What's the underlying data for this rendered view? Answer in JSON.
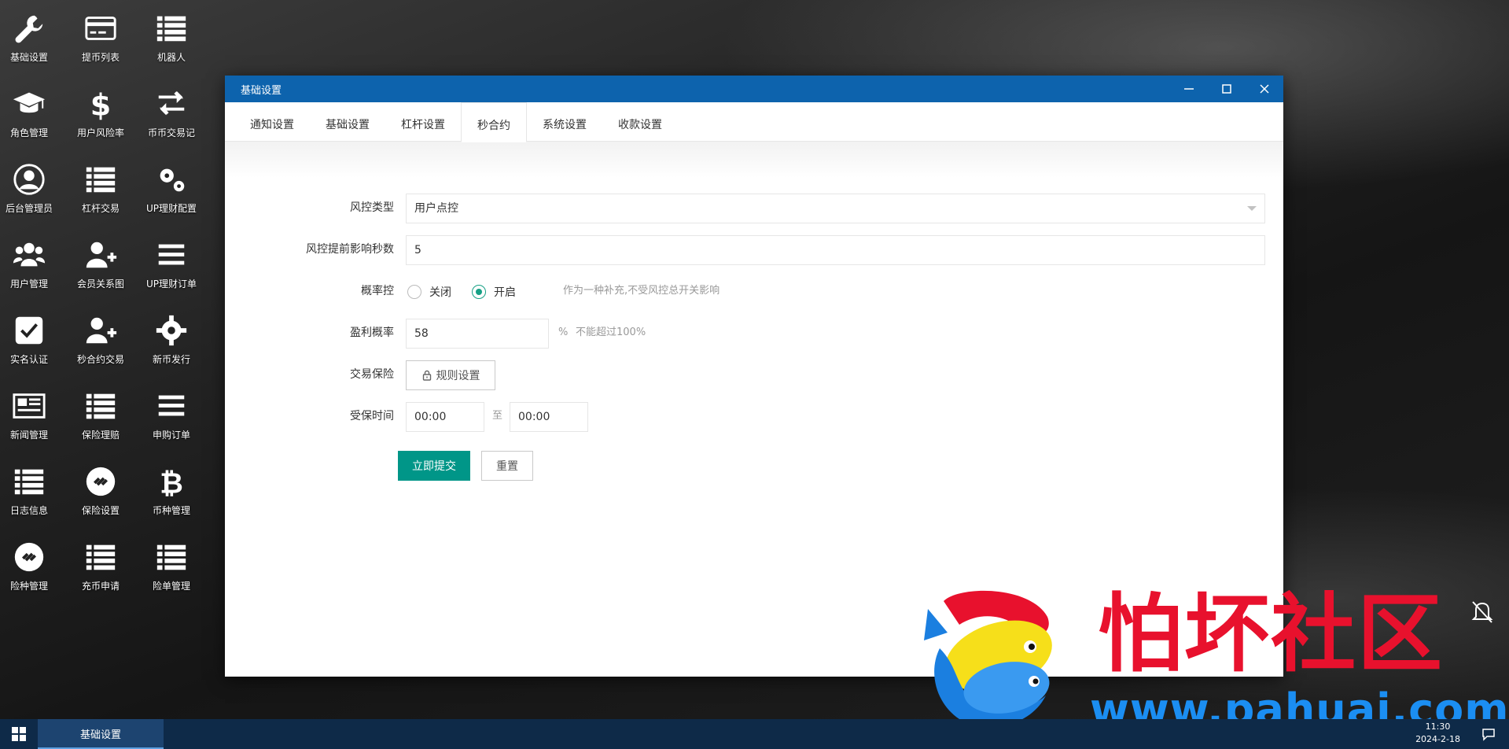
{
  "desktop": {
    "icons": [
      {
        "label": "基础设置",
        "icon": "wrench-icon"
      },
      {
        "label": "提币列表",
        "icon": "card-icon"
      },
      {
        "label": "机器人",
        "icon": "list-icon"
      },
      {
        "label": "角色管理",
        "icon": "graduation-cap-icon"
      },
      {
        "label": "用户风险率",
        "icon": "dollar-icon"
      },
      {
        "label": "币币交易记",
        "icon": "exchange-icon"
      },
      {
        "label": "后台管理员",
        "icon": "user-circle-icon"
      },
      {
        "label": "杠杆交易",
        "icon": "list-icon"
      },
      {
        "label": "UP理财配置",
        "icon": "gears-icon"
      },
      {
        "label": "用户管理",
        "icon": "users-icon"
      },
      {
        "label": "会员关系图",
        "icon": "user-plus-icon"
      },
      {
        "label": "UP理财订单",
        "icon": "bars-icon"
      },
      {
        "label": "实名认证",
        "icon": "checkbox-icon"
      },
      {
        "label": "秒合约交易",
        "icon": "user-plus-icon"
      },
      {
        "label": "新币发行",
        "icon": "gear-icon"
      },
      {
        "label": "新闻管理",
        "icon": "newspaper-icon"
      },
      {
        "label": "保险理赔",
        "icon": "list-icon"
      },
      {
        "label": "申购订单",
        "icon": "bars-icon"
      },
      {
        "label": "日志信息",
        "icon": "list-icon"
      },
      {
        "label": "保险设置",
        "icon": "link-circle-icon"
      },
      {
        "label": "币种管理",
        "icon": "bitcoin-icon"
      },
      {
        "label": "险种管理",
        "icon": "link-circle-icon"
      },
      {
        "label": "充币申请",
        "icon": "list-icon"
      },
      {
        "label": "险单管理",
        "icon": "list-icon"
      }
    ]
  },
  "window": {
    "title": "基础设置",
    "tabs": [
      {
        "label": "通知设置"
      },
      {
        "label": "基础设置"
      },
      {
        "label": "杠杆设置"
      },
      {
        "label": "秒合约",
        "active": true
      },
      {
        "label": "系统设置"
      },
      {
        "label": "收款设置"
      }
    ],
    "form": {
      "risk_type": {
        "label": "风控类型",
        "value": "用户点控"
      },
      "risk_seconds": {
        "label": "风控提前影响秒数",
        "value": "5"
      },
      "probability": {
        "label": "概率控",
        "off_label": "关闭",
        "on_label": "开启",
        "selected": "开启",
        "hint": "作为一种补充,不受风控总开关影响"
      },
      "profit_rate": {
        "label": "盈利概率",
        "value": "58",
        "unit": "%",
        "hint": "不能超过100%"
      },
      "insurance": {
        "label": "交易保险",
        "button": "规则设置"
      },
      "insured_time": {
        "label": "受保时间",
        "start": "00:00",
        "separator": "至",
        "end": "00:00"
      },
      "submit_label": "立即提交",
      "reset_label": "重置"
    }
  },
  "taskbar": {
    "active_item": "基础设置",
    "time": "11:30",
    "date": "2024-2-18"
  },
  "watermark": {
    "title": "怕坏社区",
    "url": "www.pahuai.com"
  },
  "colors": {
    "titlebar": "#0d63ad",
    "primary_button": "#009688",
    "radio_on": "#16a085",
    "taskbar": "#0e2a48",
    "watermark_red": "#e8112d",
    "watermark_blue": "#1b8ef2"
  }
}
